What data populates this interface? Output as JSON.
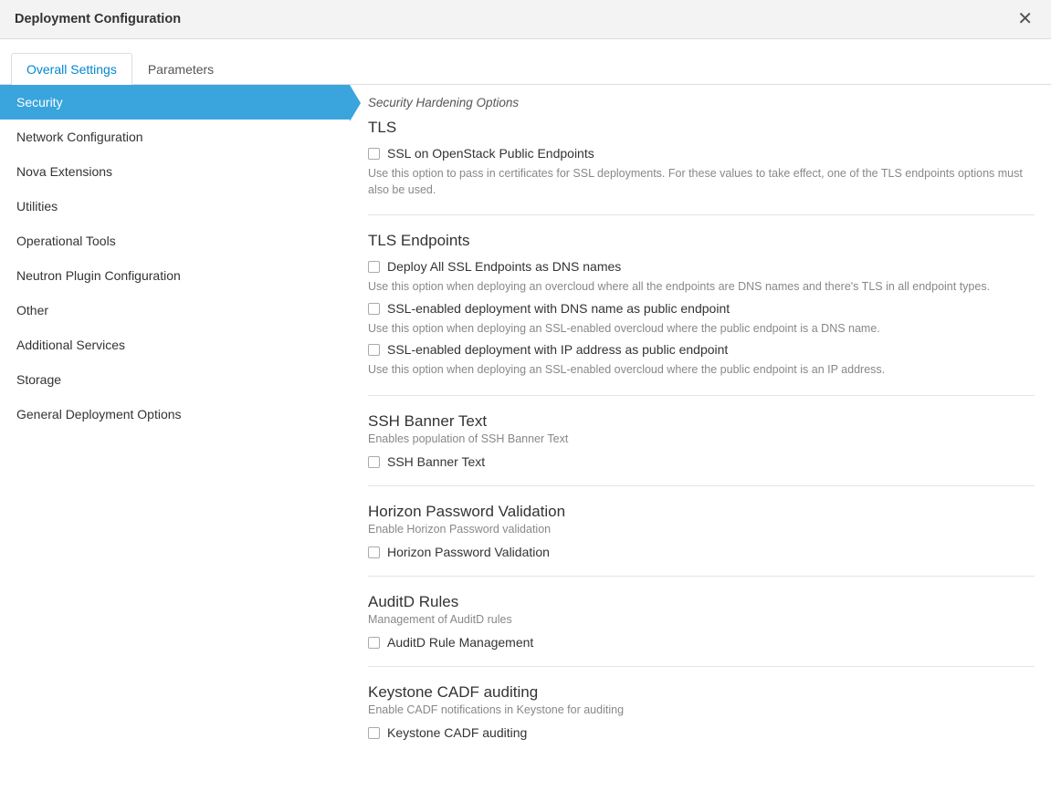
{
  "header": {
    "title": "Deployment Configuration"
  },
  "tabs": [
    {
      "label": "Overall Settings",
      "active": true
    },
    {
      "label": "Parameters",
      "active": false
    }
  ],
  "sidebar": {
    "items": [
      {
        "label": "Security",
        "active": true
      },
      {
        "label": "Network Configuration"
      },
      {
        "label": "Nova Extensions"
      },
      {
        "label": "Utilities"
      },
      {
        "label": "Operational Tools"
      },
      {
        "label": "Neutron Plugin Configuration"
      },
      {
        "label": "Other"
      },
      {
        "label": "Additional Services"
      },
      {
        "label": "Storage"
      },
      {
        "label": "General Deployment Options"
      }
    ]
  },
  "content": {
    "subtitle": "Security Hardening Options",
    "groups": [
      {
        "title": "TLS",
        "desc": null,
        "options": [
          {
            "label": "SSL on OpenStack Public Endpoints",
            "help": "Use this option to pass in certificates for SSL deployments. For these values to take effect, one of the TLS endpoints options must also be used."
          }
        ]
      },
      {
        "title": "TLS Endpoints",
        "desc": null,
        "options": [
          {
            "label": "Deploy All SSL Endpoints as DNS names",
            "help": "Use this option when deploying an overcloud where all the endpoints are DNS names and there's TLS in all endpoint types."
          },
          {
            "label": "SSL-enabled deployment with DNS name as public endpoint",
            "help": "Use this option when deploying an SSL-enabled overcloud where the public endpoint is a DNS name."
          },
          {
            "label": "SSL-enabled deployment with IP address as public endpoint",
            "help": "Use this option when deploying an SSL-enabled overcloud where the public endpoint is an IP address."
          }
        ]
      },
      {
        "title": "SSH Banner Text",
        "desc": "Enables population of SSH Banner Text",
        "options": [
          {
            "label": "SSH Banner Text",
            "help": null
          }
        ]
      },
      {
        "title": "Horizon Password Validation",
        "desc": "Enable Horizon Password validation",
        "options": [
          {
            "label": "Horizon Password Validation",
            "help": null
          }
        ]
      },
      {
        "title": "AuditD Rules",
        "desc": "Management of AuditD rules",
        "options": [
          {
            "label": "AuditD Rule Management",
            "help": null
          }
        ]
      },
      {
        "title": "Keystone CADF auditing",
        "desc": "Enable CADF notifications in Keystone for auditing",
        "options": [
          {
            "label": "Keystone CADF auditing",
            "help": null
          }
        ]
      }
    ]
  }
}
